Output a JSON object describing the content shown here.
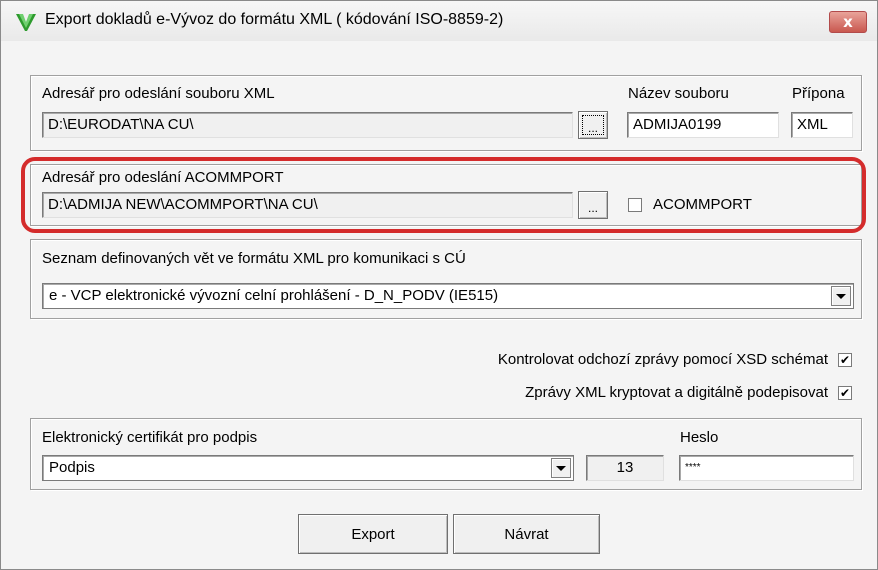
{
  "window": {
    "title": "Export dokladů e-Vývoz do formátu XML ( kódování ISO-8859-2)",
    "close_label": "x",
    "highlight_color": "#d42c2c"
  },
  "xml_dir": {
    "label": "Adresář pro odeslání souboru XML",
    "value": "D:\\EURODAT\\NA  CU\\",
    "browse_label": "...",
    "filename_label": "Název souboru",
    "filename_value": "ADMIJA0199",
    "extension_label": "Přípona",
    "extension_value": "XML"
  },
  "acommport": {
    "label": "Adresář pro odeslání ACOMMPORT",
    "value": "D:\\ADMIJA  NEW\\ACOMMPORT\\NA  CU\\",
    "browse_label": "...",
    "checkbox_label": "ACOMMPORT",
    "checked": false
  },
  "sentences": {
    "label": "Seznam definovaných vět ve formátu XML pro komunikaci s CÚ",
    "selected": "e - VCP elektronické vývozní celní prohlášení - D_N_PODV  (IE515)"
  },
  "options": {
    "validate_label": "Kontrolovat odchozí zprávy pomocí XSD schémat",
    "validate_checked": true,
    "encrypt_label": "Zprávy XML kryptovat a digitálně podepisovat",
    "encrypt_checked": true
  },
  "certificate": {
    "label": "Elektronický certifikát pro podpis",
    "selected": "Podpis",
    "number": "13",
    "password_label": "Heslo",
    "password_value": "****"
  },
  "buttons": {
    "export_label": "Export",
    "return_label": "Návrat"
  }
}
